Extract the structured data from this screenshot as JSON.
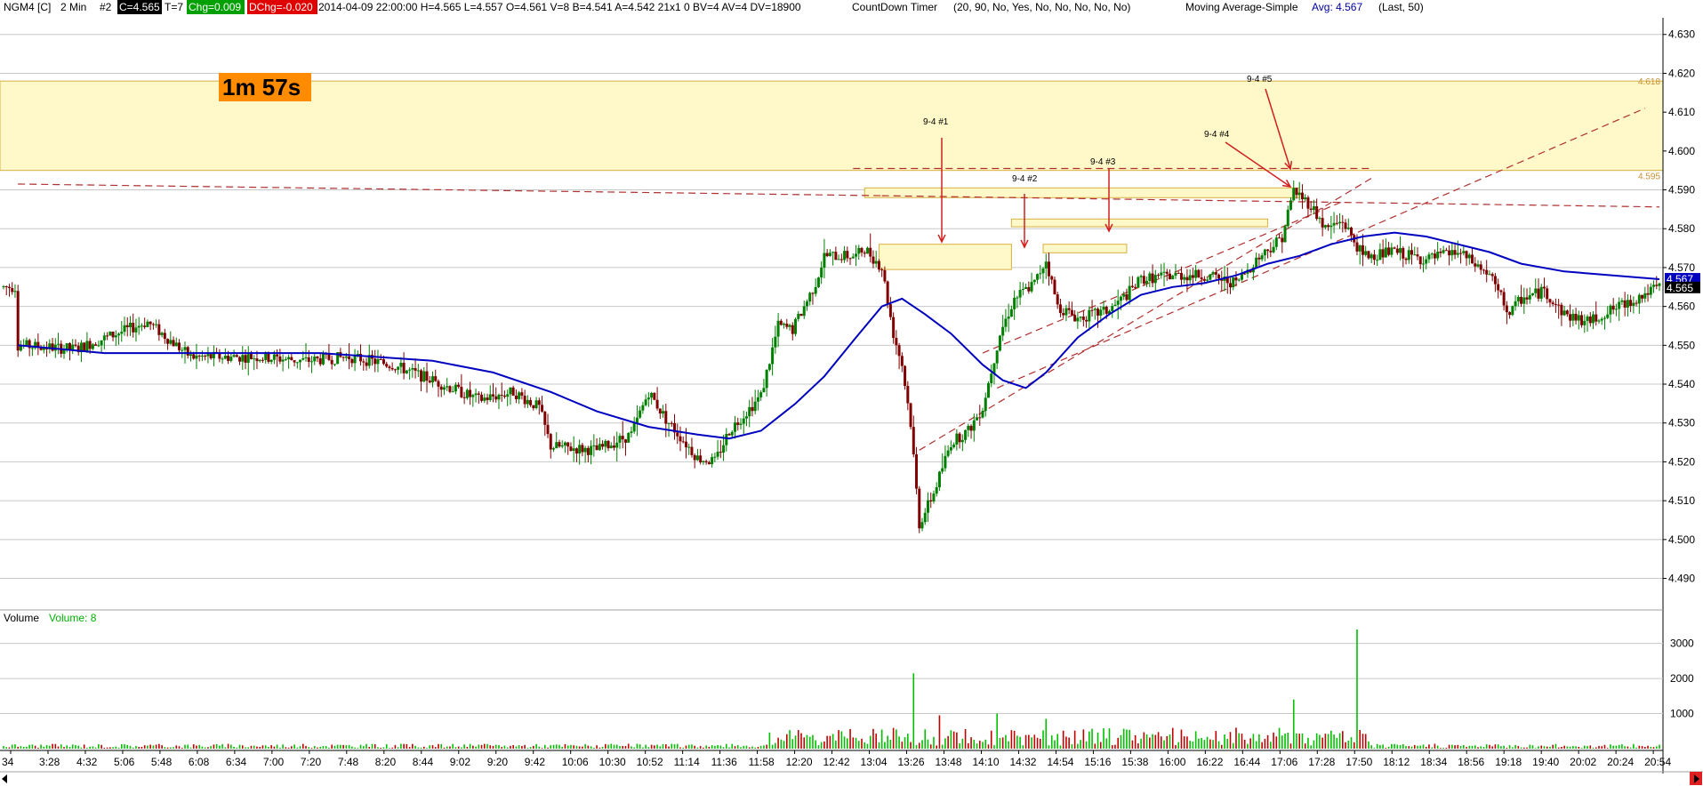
{
  "header": {
    "symbol": "NGM4 [C]",
    "interval": "2 Min",
    "chart_number": "#2",
    "close": "C=4.565",
    "ticks": "T=7",
    "chg": "Chg=0.009",
    "dchg": "DChg=-0.020",
    "bar_info": "2014-04-09 22:00:00 H=4.565 L=4.557 O=4.561 V=8 B=4.541 A=4.542 21x1 0 BV=4 AV=4 DV=18900",
    "study1": "CountDown Timer",
    "study1_params": "(20, 90, No, Yes, No, No, No, No, No)",
    "study2": "Moving Average-Simple",
    "study2_value": "Avg: 4.567",
    "study2_params": "(Last, 50)"
  },
  "colors": {
    "up_candle": "#008000",
    "down_candle": "#800000",
    "moving_average": "#0000c0",
    "zone_fill": "#fff8c8",
    "zone_stroke": "#d8b040",
    "dashed_line": "#b03030",
    "arrow": "#d02020",
    "volume": "#00c000",
    "volume_down": "#c00000",
    "timer_bg": "#ff8c00",
    "chg_bg": "#00a000",
    "dchg_bg": "#e00000",
    "close_bg": "#000000",
    "last_price_bg": "#000000",
    "avg_price_bg": "#0000c0"
  },
  "timer": {
    "label": "1m 57s"
  },
  "price_axis": {
    "ticks": [
      "4.630",
      "4.620",
      "4.610",
      "4.600",
      "4.590",
      "4.580",
      "4.570",
      "4.560",
      "4.550",
      "4.540",
      "4.530",
      "4.520",
      "4.510",
      "4.500",
      "4.490"
    ],
    "zone_top_label": "4.618",
    "zone_bottom_label": "4.595",
    "last_price": "4.565",
    "avg_price": "4.567"
  },
  "volume_pane": {
    "title": "Volume",
    "value": "Volume: 8",
    "ticks": [
      "3000",
      "2000",
      "1000"
    ]
  },
  "time_axis": {
    "labels": [
      "34",
      "3:28",
      "4:32",
      "5:06",
      "5:48",
      "6:08",
      "6:34",
      "7:00",
      "7:20",
      "7:48",
      "8:20",
      "8:44",
      "9:02",
      "9:20",
      "9:42",
      "10:06",
      "10:30",
      "10:52",
      "11:14",
      "11:36",
      "11:58",
      "12:20",
      "12:42",
      "13:04",
      "13:26",
      "13:48",
      "14:10",
      "14:32",
      "14:54",
      "15:16",
      "15:38",
      "16:00",
      "16:22",
      "16:44",
      "17:06",
      "17:28",
      "17:50",
      "18:12",
      "18:34",
      "18:56",
      "19:18",
      "19:40",
      "20:02",
      "20:24",
      "20:54"
    ]
  },
  "annotations": [
    {
      "label": "9-4 #1"
    },
    {
      "label": "9-4 #2"
    },
    {
      "label": "9-4 #3"
    },
    {
      "label": "9-4 #4"
    },
    {
      "label": "9-4 #5"
    }
  ],
  "chart_data": {
    "type": "candlestick",
    "ylim": [
      4.486,
      4.632
    ],
    "zones": [
      {
        "name": "resistance",
        "from": 4.595,
        "to": 4.618
      },
      {
        "name": "box-1",
        "x_from": "12:58",
        "x_to": "14:30",
        "from": 4.5695,
        "to": 4.576
      },
      {
        "name": "box-2",
        "x_from": "14:30",
        "x_to": "17:28",
        "from": 4.5805,
        "to": 4.5825
      },
      {
        "name": "box-3",
        "x_from": "14:52",
        "x_to": "15:50",
        "from": 4.5738,
        "to": 4.576
      },
      {
        "name": "box-4",
        "x_from": "12:48",
        "x_to": "17:50",
        "from": 4.588,
        "to": 4.5905
      }
    ],
    "price_points": [
      {
        "t": "3:00",
        "p": 4.55
      },
      {
        "t": "3:40",
        "p": 4.549
      },
      {
        "t": "4:30",
        "p": 4.556
      },
      {
        "t": "5:00",
        "p": 4.547
      },
      {
        "t": "5:48",
        "p": 4.547
      },
      {
        "t": "6:20",
        "p": 4.546
      },
      {
        "t": "6:50",
        "p": 4.547
      },
      {
        "t": "7:20",
        "p": 4.545
      },
      {
        "t": "7:48",
        "p": 4.541
      },
      {
        "t": "8:20",
        "p": 4.536
      },
      {
        "t": "8:44",
        "p": 4.538
      },
      {
        "t": "9:02",
        "p": 4.534
      },
      {
        "t": "9:10",
        "p": 4.524
      },
      {
        "t": "9:42",
        "p": 4.523
      },
      {
        "t": "10:06",
        "p": 4.527
      },
      {
        "t": "10:18",
        "p": 4.538
      },
      {
        "t": "10:30",
        "p": 4.531
      },
      {
        "t": "10:52",
        "p": 4.521
      },
      {
        "t": "11:04",
        "p": 4.52
      },
      {
        "t": "11:14",
        "p": 4.528
      },
      {
        "t": "11:36",
        "p": 4.537
      },
      {
        "t": "11:48",
        "p": 4.555
      },
      {
        "t": "11:58",
        "p": 4.554
      },
      {
        "t": "12:14",
        "p": 4.566
      },
      {
        "t": "12:20",
        "p": 4.573
      },
      {
        "t": "12:42",
        "p": 4.573
      },
      {
        "t": "12:48",
        "p": 4.575
      },
      {
        "t": "13:00",
        "p": 4.57
      },
      {
        "t": "13:08",
        "p": 4.553
      },
      {
        "t": "13:14",
        "p": 4.545
      },
      {
        "t": "13:20",
        "p": 4.53
      },
      {
        "t": "13:26",
        "p": 4.504
      },
      {
        "t": "13:36",
        "p": 4.512
      },
      {
        "t": "13:48",
        "p": 4.525
      },
      {
        "t": "14:00",
        "p": 4.528
      },
      {
        "t": "14:10",
        "p": 4.534
      },
      {
        "t": "14:22",
        "p": 4.553
      },
      {
        "t": "14:32",
        "p": 4.562
      },
      {
        "t": "14:46",
        "p": 4.566
      },
      {
        "t": "14:54",
        "p": 4.572
      },
      {
        "t": "15:02",
        "p": 4.56
      },
      {
        "t": "15:16",
        "p": 4.557
      },
      {
        "t": "15:38",
        "p": 4.559
      },
      {
        "t": "15:50",
        "p": 4.563
      },
      {
        "t": "16:00",
        "p": 4.567
      },
      {
        "t": "16:22",
        "p": 4.568
      },
      {
        "t": "16:44",
        "p": 4.568
      },
      {
        "t": "17:06",
        "p": 4.566
      },
      {
        "t": "17:20",
        "p": 4.572
      },
      {
        "t": "17:38",
        "p": 4.578
      },
      {
        "t": "17:46",
        "p": 4.59
      },
      {
        "t": "17:58",
        "p": 4.586
      },
      {
        "t": "18:08",
        "p": 4.58
      },
      {
        "t": "18:20",
        "p": 4.582
      },
      {
        "t": "18:34",
        "p": 4.573
      },
      {
        "t": "18:56",
        "p": 4.574
      },
      {
        "t": "19:18",
        "p": 4.572
      },
      {
        "t": "19:40",
        "p": 4.574
      },
      {
        "t": "20:02",
        "p": 4.568
      },
      {
        "t": "20:16",
        "p": 4.558
      },
      {
        "t": "20:24",
        "p": 4.562
      },
      {
        "t": "20:40",
        "p": 4.564
      },
      {
        "t": "20:54",
        "p": 4.558
      },
      {
        "t": "21:10",
        "p": 4.556
      },
      {
        "t": "22:00",
        "p": 4.565
      }
    ],
    "moving_average_points": [
      {
        "t": "3:00",
        "p": 4.55
      },
      {
        "t": "4:00",
        "p": 4.548
      },
      {
        "t": "5:48",
        "p": 4.548
      },
      {
        "t": "6:30",
        "p": 4.548
      },
      {
        "t": "7:48",
        "p": 4.546
      },
      {
        "t": "8:30",
        "p": 4.543
      },
      {
        "t": "9:10",
        "p": 4.538
      },
      {
        "t": "9:42",
        "p": 4.533
      },
      {
        "t": "10:18",
        "p": 4.529
      },
      {
        "t": "10:52",
        "p": 4.527
      },
      {
        "t": "11:14",
        "p": 4.526
      },
      {
        "t": "11:36",
        "p": 4.528
      },
      {
        "t": "12:00",
        "p": 4.535
      },
      {
        "t": "12:20",
        "p": 4.542
      },
      {
        "t": "12:42",
        "p": 4.552
      },
      {
        "t": "13:00",
        "p": 4.56
      },
      {
        "t": "13:14",
        "p": 4.562
      },
      {
        "t": "13:30",
        "p": 4.558
      },
      {
        "t": "13:48",
        "p": 4.553
      },
      {
        "t": "14:10",
        "p": 4.545
      },
      {
        "t": "14:24",
        "p": 4.541
      },
      {
        "t": "14:40",
        "p": 4.539
      },
      {
        "t": "14:54",
        "p": 4.543
      },
      {
        "t": "15:16",
        "p": 4.552
      },
      {
        "t": "15:38",
        "p": 4.558
      },
      {
        "t": "16:00",
        "p": 4.563
      },
      {
        "t": "16:22",
        "p": 4.565
      },
      {
        "t": "16:44",
        "p": 4.566
      },
      {
        "t": "17:06",
        "p": 4.568
      },
      {
        "t": "17:28",
        "p": 4.571
      },
      {
        "t": "17:50",
        "p": 4.573
      },
      {
        "t": "18:12",
        "p": 4.576
      },
      {
        "t": "18:34",
        "p": 4.578
      },
      {
        "t": "18:56",
        "p": 4.579
      },
      {
        "t": "19:18",
        "p": 4.578
      },
      {
        "t": "19:40",
        "p": 4.576
      },
      {
        "t": "20:02",
        "p": 4.574
      },
      {
        "t": "20:24",
        "p": 4.571
      },
      {
        "t": "20:54",
        "p": 4.569
      },
      {
        "t": "22:00",
        "p": 4.567
      }
    ],
    "volume_spikes": [
      {
        "t": "13:22",
        "v": 2150
      },
      {
        "t": "18:30",
        "v": 3400
      },
      {
        "t": "17:46",
        "v": 1400
      },
      {
        "t": "14:20",
        "v": 1000
      },
      {
        "t": "13:40",
        "v": 950
      },
      {
        "t": "14:54",
        "v": 850
      }
    ]
  }
}
